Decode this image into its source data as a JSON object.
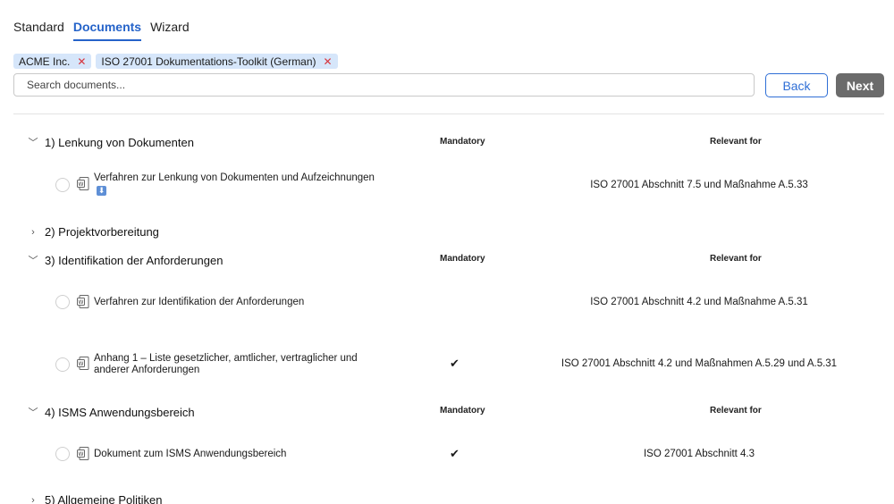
{
  "tabs": [
    {
      "label": "Standard"
    },
    {
      "label": "Documents"
    },
    {
      "label": "Wizard"
    }
  ],
  "filters": [
    {
      "label": "ACME Inc."
    },
    {
      "label": "ISO 27001 Dokumentations-Toolkit (German)"
    }
  ],
  "search": {
    "placeholder": "Search documents..."
  },
  "buttons": {
    "back": "Back",
    "next": "Next"
  },
  "columns": {
    "mandatory": "Mandatory",
    "relevant": "Relevant for"
  },
  "mandatory_mark": "✔",
  "sections": [
    {
      "title": "1) Lenkung von Dokumenten",
      "expanded": true,
      "docs": [
        {
          "title": "Verfahren zur Lenkung von Dokumenten und Aufzeichnungen",
          "mandatory": false,
          "relevant": "ISO 27001 Abschnitt 7.5 und Maßnahme A.5.33",
          "download_icon": "download-icon"
        }
      ]
    },
    {
      "title": "2) Projektvorbereitung",
      "expanded": false
    },
    {
      "title": "3) Identifikation der Anforderungen",
      "expanded": true,
      "docs": [
        {
          "title": "Verfahren zur Identifikation der Anforderungen",
          "mandatory": false,
          "relevant": "ISO 27001 Abschnitt 4.2 und Maßnahme A.5.31"
        },
        {
          "title": "Anhang 1 – Liste gesetzlicher, amtlicher, vertraglicher und anderer Anforderungen",
          "mandatory": true,
          "relevant": "ISO 27001 Abschnitt 4.2 und Maßnahmen A.5.29 und A.5.31"
        }
      ]
    },
    {
      "title": "4) ISMS Anwendungsbereich",
      "expanded": true,
      "docs": [
        {
          "title": "Dokument zum ISMS Anwendungsbereich",
          "mandatory": true,
          "relevant": "ISO 27001 Abschnitt 4.3"
        }
      ]
    },
    {
      "title": "5) Allgemeine Politiken",
      "expanded": false
    }
  ],
  "colors": {
    "accent": "#2563c9",
    "chip_bg": "#d6e6fa",
    "chip_close": "#d6343c",
    "next_bg": "#6b6b6b"
  },
  "icons": {
    "expanded": "chevron-down-icon",
    "collapsed": "chevron-right-icon",
    "document": "word-document-icon"
  }
}
